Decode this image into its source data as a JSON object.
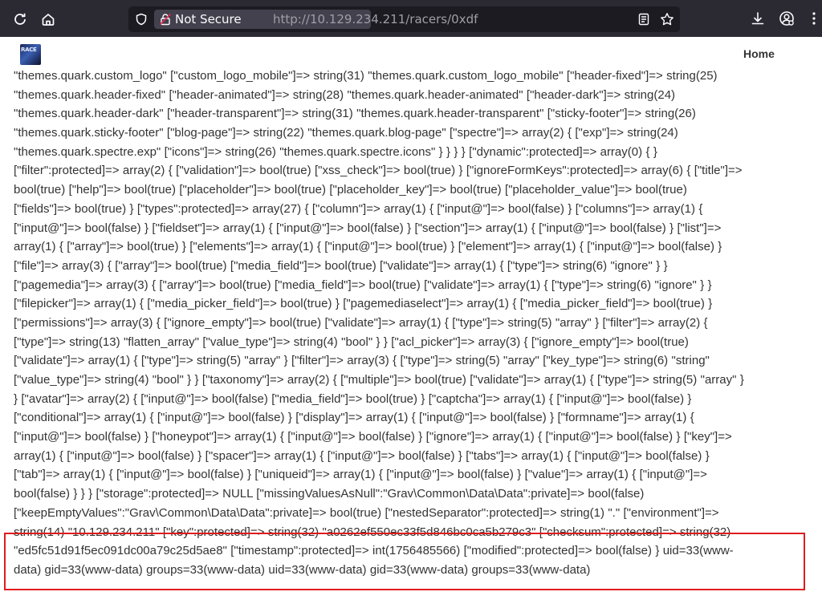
{
  "browser": {
    "security_label": "Not Secure",
    "url_host": "http://10.129.234.211",
    "url_path": "/racers/0xdf"
  },
  "site": {
    "logo_text": "RACE",
    "nav_home": "Home"
  },
  "dump_lines": [
    "\"themes.quark.custom_logo\" [\"custom_logo_mobile\"]=> string(31) \"themes.quark.custom_logo_mobile\" [\"header-fixed\"]=> string(25)",
    "\"themes.quark.header-fixed\" [\"header-animated\"]=> string(28) \"themes.quark.header-animated\" [\"header-dark\"]=> string(24)",
    "\"themes.quark.header-dark\" [\"header-transparent\"]=> string(31) \"themes.quark.header-transparent\" [\"sticky-footer\"]=> string(26)",
    "\"themes.quark.sticky-footer\" [\"blog-page\"]=> string(22) \"themes.quark.blog-page\" [\"spectre\"]=> array(2) { [\"exp\"]=> string(24)",
    "\"themes.quark.spectre.exp\" [\"icons\"]=> string(26) \"themes.quark.spectre.icons\" } } } } [\"dynamic\":protected]=> array(0) { }",
    "[\"filter\":protected]=> array(2) { [\"validation\"]=> bool(true) [\"xss_check\"]=> bool(true) } [\"ignoreFormKeys\":protected]=> array(6) { [\"title\"]=>",
    "bool(true) [\"help\"]=> bool(true) [\"placeholder\"]=> bool(true) [\"placeholder_key\"]=> bool(true) [\"placeholder_value\"]=> bool(true)",
    "[\"fields\"]=> bool(true) } [\"types\":protected]=> array(27) { [\"column\"]=> array(1) { [\"input@\"]=> bool(false) } [\"columns\"]=> array(1) {",
    "[\"input@\"]=> bool(false) } [\"fieldset\"]=> array(1) { [\"input@\"]=> bool(false) } [\"section\"]=> array(1) { [\"input@\"]=> bool(false) } [\"list\"]=>",
    "array(1) { [\"array\"]=> bool(true) } [\"elements\"]=> array(1) { [\"input@\"]=> bool(true) } [\"element\"]=> array(1) { [\"input@\"]=> bool(false) }",
    "[\"file\"]=> array(3) { [\"array\"]=> bool(true) [\"media_field\"]=> bool(true) [\"validate\"]=> array(1) { [\"type\"]=> string(6) \"ignore\" } }",
    "[\"pagemedia\"]=> array(3) { [\"array\"]=> bool(true) [\"media_field\"]=> bool(true) [\"validate\"]=> array(1) { [\"type\"]=> string(6) \"ignore\" } }",
    "[\"filepicker\"]=> array(1) { [\"media_picker_field\"]=> bool(true) } [\"pagemediaselect\"]=> array(1) { [\"media_picker_field\"]=> bool(true) }",
    "[\"permissions\"]=> array(3) { [\"ignore_empty\"]=> bool(true) [\"validate\"]=> array(1) { [\"type\"]=> string(5) \"array\" } [\"filter\"]=> array(2) {",
    "[\"type\"]=> string(13) \"flatten_array\" [\"value_type\"]=> string(4) \"bool\" } } [\"acl_picker\"]=> array(3) { [\"ignore_empty\"]=> bool(true)",
    "[\"validate\"]=> array(1) { [\"type\"]=> string(5) \"array\" } [\"filter\"]=> array(3) { [\"type\"]=> string(5) \"array\" [\"key_type\"]=> string(6) \"string\"",
    "[\"value_type\"]=> string(4) \"bool\" } } [\"taxonomy\"]=> array(2) { [\"multiple\"]=> bool(true) [\"validate\"]=> array(1) { [\"type\"]=> string(5) \"array\" }",
    "} [\"avatar\"]=> array(2) { [\"input@\"]=> bool(false) [\"media_field\"]=> bool(true) } [\"captcha\"]=> array(1) { [\"input@\"]=> bool(false) }",
    "[\"conditional\"]=> array(1) { [\"input@\"]=> bool(false) } [\"display\"]=> array(1) { [\"input@\"]=> bool(false) } [\"formname\"]=> array(1) {",
    "[\"input@\"]=> bool(false) } [\"honeypot\"]=> array(1) { [\"input@\"]=> bool(false) } [\"ignore\"]=> array(1) { [\"input@\"]=> bool(false) } [\"key\"]=>",
    "array(1) { [\"input@\"]=> bool(false) } [\"spacer\"]=> array(1) { [\"input@\"]=> bool(false) } [\"tabs\"]=> array(1) { [\"input@\"]=> bool(false) }",
    "[\"tab\"]=> array(1) { [\"input@\"]=> bool(false) } [\"uniqueid\"]=> array(1) { [\"input@\"]=> bool(false) } [\"value\"]=> array(1) { [\"input@\"]=>",
    "bool(false) } } } [\"storage\":protected]=> NULL [\"missingValuesAsNull\":\"Grav\\Common\\Data\\Data\":private]=> bool(false)",
    "[\"keepEmptyValues\":\"Grav\\Common\\Data\\Data\":private]=> bool(true) [\"nestedSeparator\":protected]=> string(1) \".\" [\"environment\"]=>",
    "string(14) \"10.129.234.211\" [\"key\":protected]=> string(32) \"a0262ef550ec33f5d846bc0ca5b279c3\" [\"checksum\":protected]=> string(32)",
    "\"ed5fc51d91f5ec091dc00a79c25d5ae8\" [\"timestamp\":protected]=> int(1756485566) [\"modified\":protected]=> bool(false) } uid=33(www-",
    "data) gid=33(www-data) groups=33(www-data) uid=33(www-data) gid=33(www-data) groups=33(www-data)"
  ]
}
